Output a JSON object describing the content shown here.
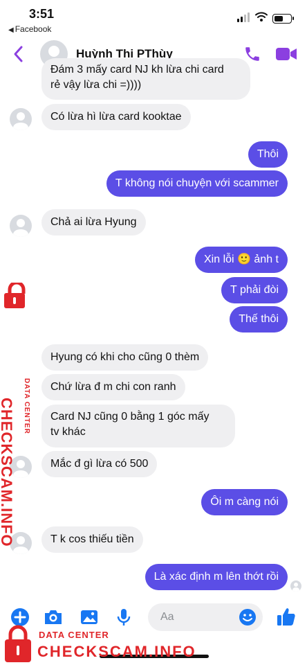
{
  "status_bar": {
    "time": "3:51",
    "back_app": "Facebook"
  },
  "header": {
    "contact_name": "Huỳnh Thị PThùy"
  },
  "messages": [
    {
      "dir": "in",
      "text": "Đám 3 mấy card NJ kh lừa chi card",
      "text2": "rẻ vậy lừa chi =))))"
    },
    {
      "dir": "in",
      "text": "Có lừa hì lừa card kooktae"
    },
    {
      "dir": "out",
      "text": "Thôi"
    },
    {
      "dir": "out",
      "text": "T không nói chuyện với scammer"
    },
    {
      "dir": "in",
      "text": "Chả ai lừa Hyung"
    },
    {
      "dir": "out",
      "text": "Xin lỗi",
      "emoji": "🙂",
      "text_after": "ảnh t"
    },
    {
      "dir": "out",
      "text": "T phải đòi"
    },
    {
      "dir": "out",
      "text": "Thế thôi"
    },
    {
      "dir": "in",
      "text": "Hyung có khi cho cũng 0 thèm"
    },
    {
      "dir": "in",
      "text": "Chứ lừa đ m chi con ranh"
    },
    {
      "dir": "in",
      "text": "Card NJ cũng 0 bằng 1 góc mấy",
      "text2": "tv khác"
    },
    {
      "dir": "in",
      "text": "Mắc đ gì lừa có 500"
    },
    {
      "dir": "out",
      "text": "Ôi m càng nói"
    },
    {
      "dir": "in",
      "text": "T k cos thiếu tiền"
    },
    {
      "dir": "out",
      "text": "Là xác định m lên thớt rồi"
    }
  ],
  "composer": {
    "placeholder": "Aa",
    "icons": [
      "plus-icon",
      "camera-icon",
      "image-icon",
      "microphone-icon",
      "emoji-icon",
      "thumbs-up-icon"
    ]
  },
  "watermark": {
    "subtitle": "DATA CENTER",
    "title": "CHECKSCAM.INFO"
  },
  "colors": {
    "accent": "#8b3fe0",
    "outgoing_bubble": "#5b4ee6",
    "incoming_bubble": "#efeff1",
    "composer_blue": "#1877f2",
    "watermark_red": "#e0262a"
  }
}
